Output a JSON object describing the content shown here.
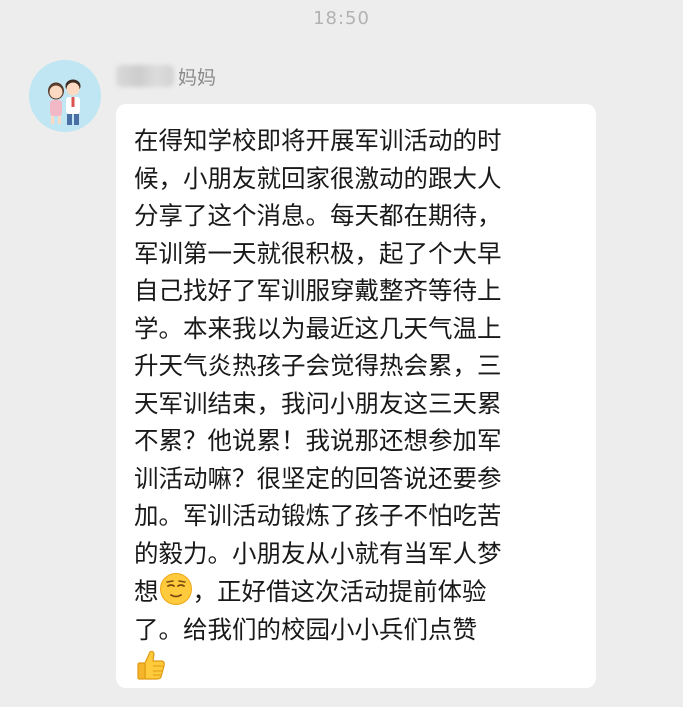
{
  "status": {
    "time": "18:50"
  },
  "message": {
    "sender_name": "妈妈",
    "lines": [
      "在得知学校即将开展军训活动的时",
      "候，小朋友就回家很激动的跟大人",
      "分享了这个消息。每天都在期待，",
      "军训第一天就很积极，起了个大早",
      "自己找好了军训服穿戴整齐等待上",
      "学。本来我以为最近这几天气温上",
      "升天气炎热孩子会觉得热会累，三",
      "天军训结束，我问小朋友这三天累",
      "不累？他说累！我说那还想参加军",
      "训活动嘛？很坚定的回答说还要参",
      "加。军训活动锻炼了孩子不怕吃苦",
      "的毅力。小朋友从小就有当军人梦",
      "想",
      "，正好借这次活动提前体验",
      "了。给我们的校园小小兵们点赞"
    ],
    "emojis": [
      "relieved-face-icon",
      "thumbs-up-icon"
    ]
  },
  "colors": {
    "background": "#ededed",
    "bubble": "#ffffff",
    "text": "#191919",
    "timestamp": "#b2b2b2",
    "sender": "#8c8c8c"
  }
}
